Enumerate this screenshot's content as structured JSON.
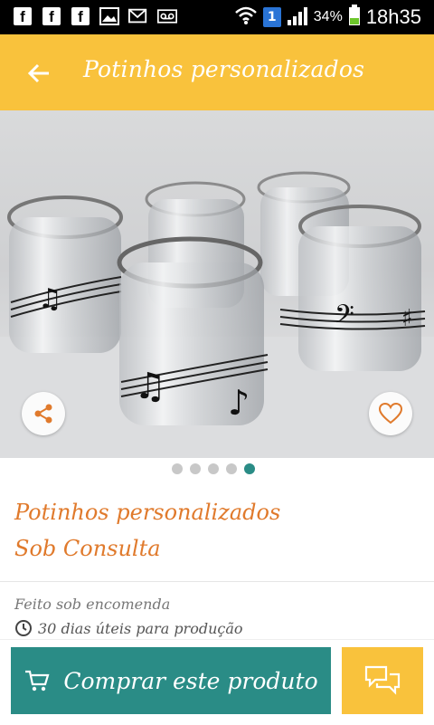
{
  "status_bar": {
    "sim_slot": "1",
    "battery_pct": "34%",
    "time": "18h35"
  },
  "app_bar": {
    "title": "Potinhos personalizados"
  },
  "carousel": {
    "total": 5,
    "active_index": 4
  },
  "product": {
    "title": "Potinhos personalizados",
    "price": "Sob Consulta",
    "made_to_order": "Feito sob encomenda",
    "production_time": "30 dias úteis para produção"
  },
  "actions": {
    "buy_label": "Comprar este produto"
  },
  "colors": {
    "accent_yellow": "#f9c23c",
    "accent_teal": "#2a8c86",
    "title_orange": "#e07a2c"
  }
}
